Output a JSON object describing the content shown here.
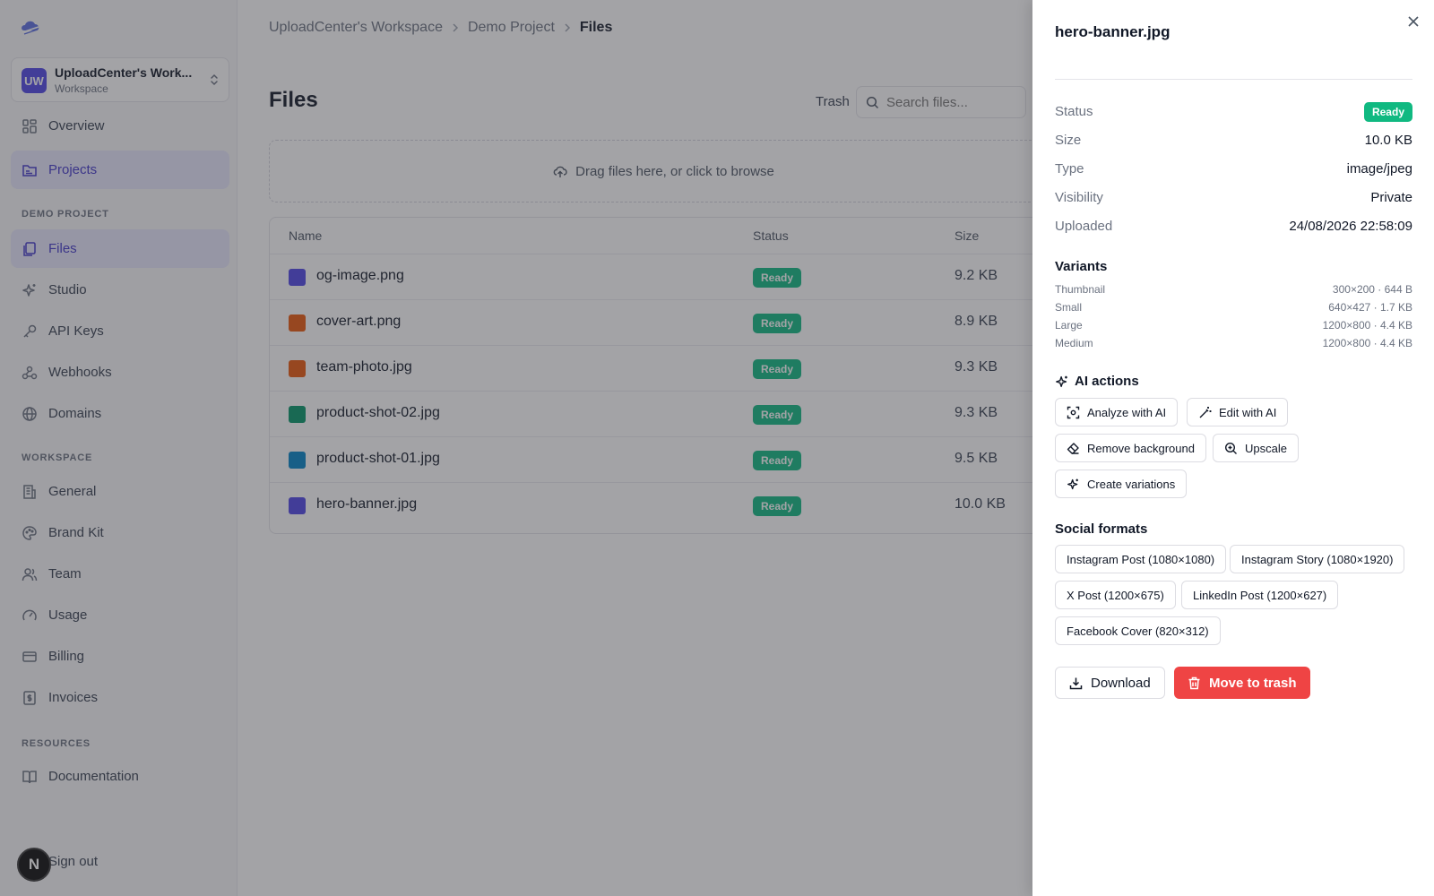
{
  "sidebar": {
    "workspace": {
      "initials": "UW",
      "name": "UploadCenter's Work...",
      "subtitle": "Workspace"
    },
    "top_items": [
      {
        "label": "Overview",
        "icon": "grid-icon"
      },
      {
        "label": "Projects",
        "icon": "folder-icon",
        "active": true
      }
    ],
    "sections": [
      {
        "label": "DEMO PROJECT",
        "items": [
          {
            "label": "Files",
            "icon": "files-icon",
            "active": true
          },
          {
            "label": "Studio",
            "icon": "sparkles-icon"
          },
          {
            "label": "API Keys",
            "icon": "key-icon"
          },
          {
            "label": "Webhooks",
            "icon": "webhook-icon"
          },
          {
            "label": "Domains",
            "icon": "globe-icon"
          }
        ]
      },
      {
        "label": "WORKSPACE",
        "items": [
          {
            "label": "General",
            "icon": "building-icon"
          },
          {
            "label": "Brand Kit",
            "icon": "palette-icon"
          },
          {
            "label": "Team",
            "icon": "users-icon"
          },
          {
            "label": "Usage",
            "icon": "gauge-icon"
          },
          {
            "label": "Billing",
            "icon": "credit-card-icon"
          },
          {
            "label": "Invoices",
            "icon": "receipt-icon"
          }
        ]
      },
      {
        "label": "RESOURCES",
        "items": [
          {
            "label": "Documentation",
            "icon": "book-icon"
          }
        ]
      }
    ],
    "signout": "Sign out",
    "dev_badge": "N"
  },
  "breadcrumb": [
    "UploadCenter's Workspace",
    "Demo Project",
    "Files"
  ],
  "page": {
    "title": "Files",
    "trash_link": "Trash",
    "search_placeholder": "Search files...",
    "dropzone_text": "Drag files here, or click to browse"
  },
  "table": {
    "columns": [
      "Name",
      "Status",
      "Size"
    ],
    "rows": [
      {
        "name": "og-image.png",
        "status": "Ready",
        "size": "9.2 KB",
        "color": "#4f46e5"
      },
      {
        "name": "cover-art.png",
        "status": "Ready",
        "size": "8.9 KB",
        "color": "#ea580c"
      },
      {
        "name": "team-photo.jpg",
        "status": "Ready",
        "size": "9.3 KB",
        "color": "#ea580c"
      },
      {
        "name": "product-shot-02.jpg",
        "status": "Ready",
        "size": "9.3 KB",
        "color": "#059669"
      },
      {
        "name": "product-shot-01.jpg",
        "status": "Ready",
        "size": "9.5 KB",
        "color": "#0284c7"
      },
      {
        "name": "hero-banner.jpg",
        "status": "Ready",
        "size": "10.0 KB",
        "color": "#4f46e5"
      }
    ]
  },
  "drawer": {
    "title": "hero-banner.jpg",
    "meta": [
      {
        "key": "Status",
        "value": "Ready",
        "badge": true
      },
      {
        "key": "Size",
        "value": "10.0 KB"
      },
      {
        "key": "Type",
        "value": "image/jpeg"
      },
      {
        "key": "Visibility",
        "value": "Private"
      },
      {
        "key": "Uploaded",
        "value": "24/08/2026 22:58:09"
      }
    ],
    "variants_title": "Variants",
    "variants": [
      {
        "name": "Thumbnail",
        "value": "300×200 · 644 B"
      },
      {
        "name": "Small",
        "value": "640×427 · 1.7 KB"
      },
      {
        "name": "Large",
        "value": "1200×800 · 4.4 KB"
      },
      {
        "name": "Medium",
        "value": "1200×800 · 4.4 KB"
      }
    ],
    "ai_title": "AI actions",
    "ai_actions": [
      "Analyze with AI",
      "Edit with AI",
      "Remove background",
      "Upscale",
      "Create variations"
    ],
    "social_title": "Social formats",
    "social_formats": [
      "Instagram Post (1080×1080)",
      "Instagram Story (1080×1920)",
      "X Post (1200×675)",
      "LinkedIn Post (1200×627)",
      "Facebook Cover (820×312)"
    ],
    "download": "Download",
    "trash": "Move to trash"
  },
  "colors": {
    "accent": "#4f46e5",
    "ready": "#10b981",
    "danger": "#ef4444"
  }
}
